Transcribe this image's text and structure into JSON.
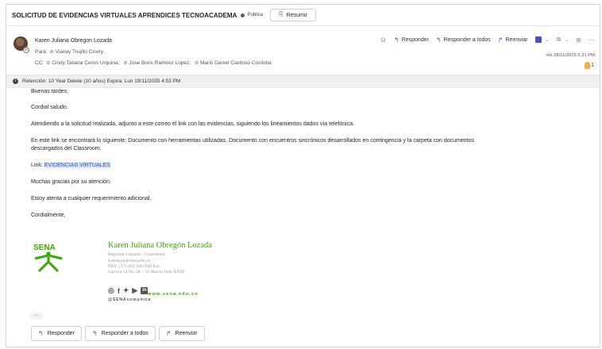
{
  "subject_bar": {
    "subject": "SOLICITUD DE EVIDENCIAS VIRTUALES  APRENDICES TECNOACADEMA",
    "visibility": "Pública",
    "summarize_label": "Resumir"
  },
  "header": {
    "sender": "Karen Juliana Obregon Lozada",
    "to_prefix": "Para:",
    "to": [
      "Vianey Trujillo Cicery"
    ],
    "cc_prefix": "CC:",
    "cc": [
      "Cindy Tatiana Ceron Urquina;",
      "Jose Boris Ramirez Lopez;",
      "Mario Daniel Cardoso Cordoba"
    ],
    "actions": {
      "reply": "Responder",
      "reply_all": "Responder a todos",
      "forward": "Reenviar"
    },
    "date": "Vie 28/11/2025 5:31 PM",
    "reaction_count": "1"
  },
  "retention": {
    "text": "Retención: 10 Year Delete (10 años) Expira: Lun 19/11/2035 4:53 PM"
  },
  "body": {
    "greeting": "Buenas tardes.",
    "salutation": "Cordial saludo.",
    "p1": "Atendiendo a la solicitud realizada, adjunto a este correo el link con las evidencias, siguiendo los lineamientos dados vía telefónica.",
    "p2_line1": "En este link se encontrará lo siguiente: Documento con herramientas utilizadas, Documento con encuentros sincrónicos desarrollados en contingencia y la carpeta con documentos",
    "p2_line2": "descargados del Classroom.",
    "link_prefix": "Link: ",
    "link_text": "EVIDENCIAS VIRTUALES",
    "thanks": "Muchas gracias por su atención.",
    "available": "Estoy atenta a cualquier requerimiento adicional.",
    "closing": "Cordialmente,"
  },
  "signature": {
    "logo_text": "SENA",
    "name": "Karen Juliana Obregón Lozada",
    "role": "Regional Caquetá - Contratista",
    "email": "kobregon@sena.edu.co",
    "phone": "PBX: (57) 601 5461500 Ext:",
    "address": "Carrera 14 No 5B – 56 Barrio Juan XXIII",
    "website": "www.sena.edu.co",
    "handle": "@SENAcomunica"
  },
  "footer": {
    "more": "...",
    "reply": "Responder",
    "reply_all": "Responder a todos",
    "forward": "Reenviar"
  },
  "colors": {
    "sena_green": "#39a900",
    "link_blue": "#1f4fd6",
    "action_blue": "#3a6fb5"
  }
}
